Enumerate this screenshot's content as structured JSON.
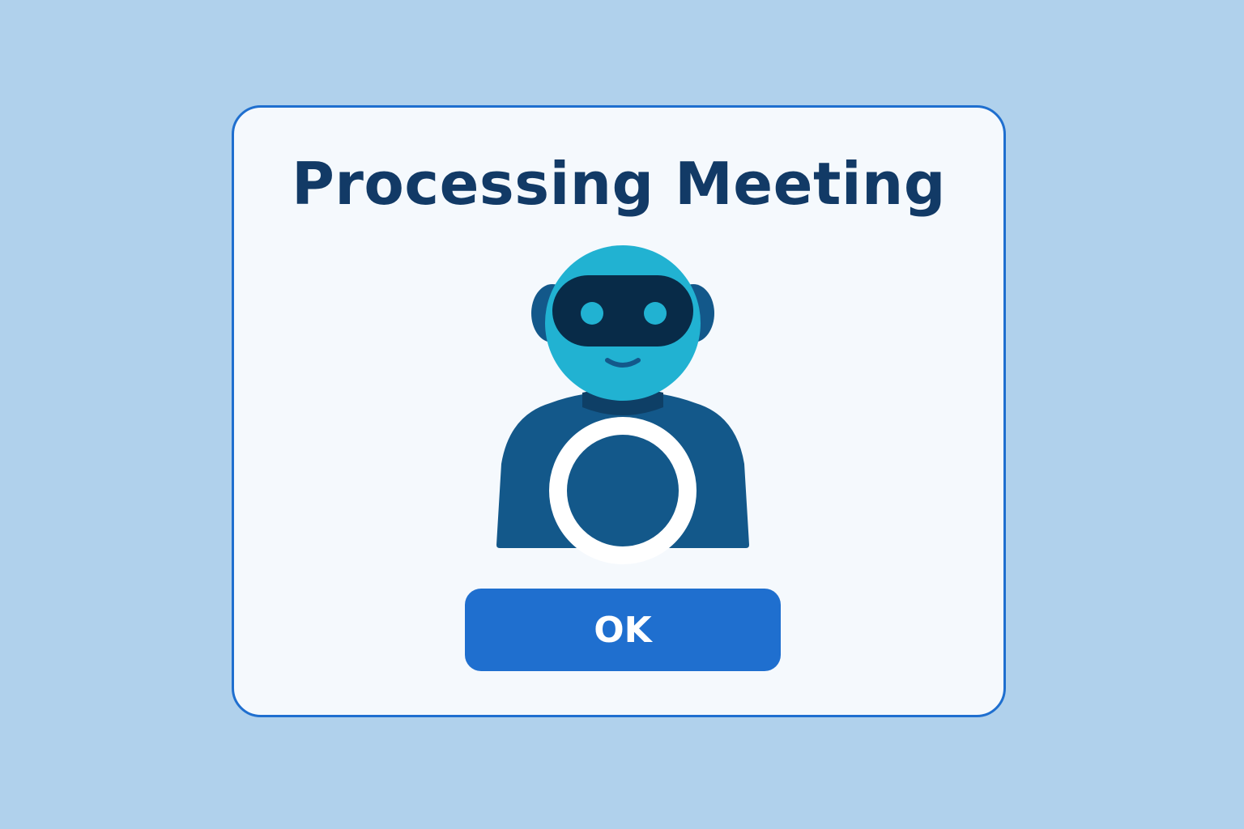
{
  "dialog": {
    "title": "Processing Meeting",
    "ok_label": "OK"
  },
  "illustration": {
    "icon": "robot-assistant-icon",
    "status_icon": "loading-ring-icon"
  },
  "colors": {
    "background": "#b0d1ec",
    "dialog_border": "#1f6fcf",
    "title_text": "#123a66",
    "button": "#1f6fcf",
    "robot_head": "#21b2d2",
    "robot_body": "#13588a",
    "robot_visor": "#082b48"
  }
}
